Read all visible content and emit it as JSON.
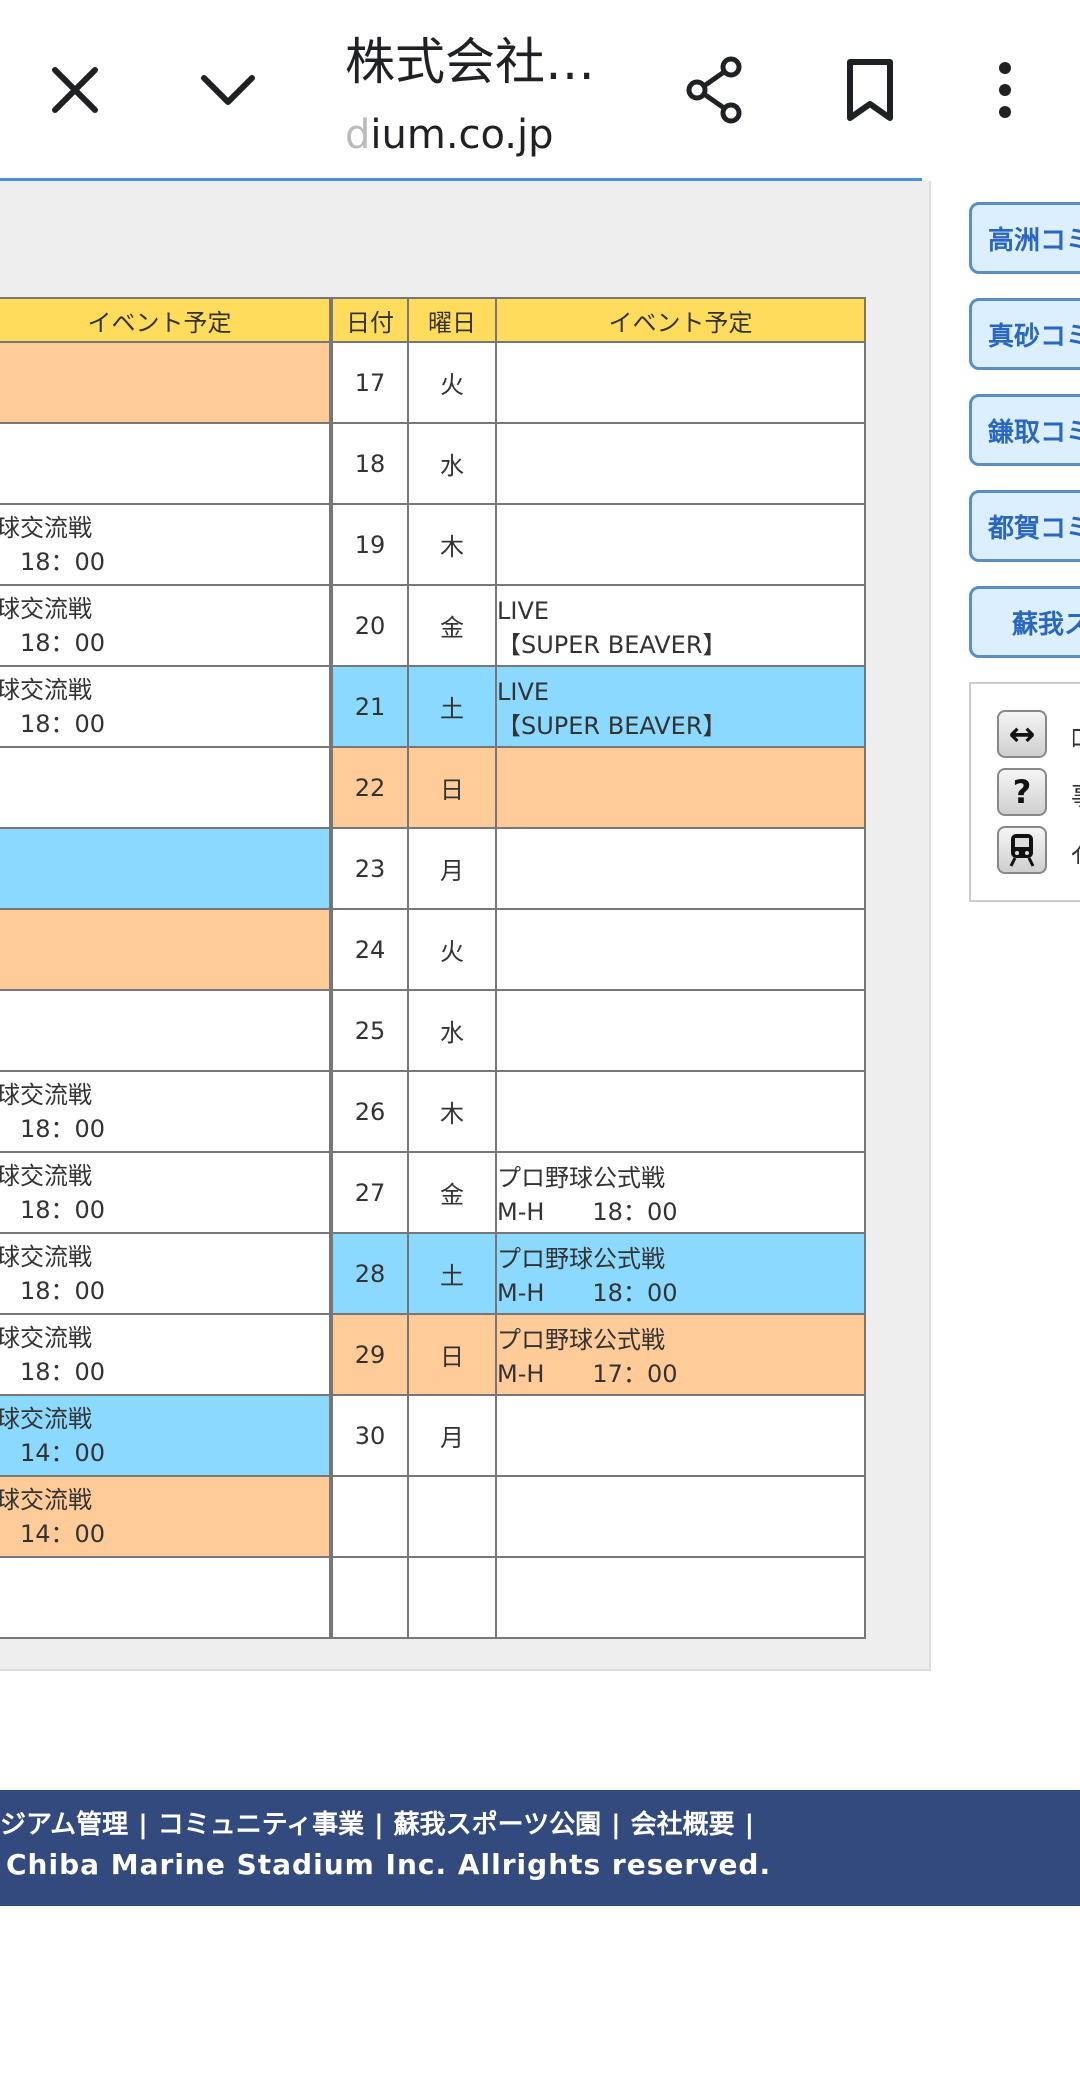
{
  "browser": {
    "title": "株式会社…",
    "url_faded": "d",
    "url": "ium.co.jp",
    "icons": [
      "close-icon",
      "chevron-down-icon",
      "share-icon",
      "bookmark-icon",
      "more-vert-icon"
    ]
  },
  "table": {
    "headers": {
      "event_left": "イベント予定",
      "date": "日付",
      "weekday": "曜日",
      "event_right": "イベント予定"
    },
    "rows": [
      {
        "left": [
          "",
          ""
        ],
        "left_color": "orange",
        "date": "17",
        "weekday": "火",
        "right": [
          "",
          ""
        ],
        "day_color": "",
        "right_color": ""
      },
      {
        "left": [
          "",
          ""
        ],
        "left_color": "",
        "date": "18",
        "weekday": "水",
        "right": [
          "",
          ""
        ],
        "day_color": "",
        "right_color": ""
      },
      {
        "left": [
          "球交流戦",
          "　18：00"
        ],
        "left_color": "",
        "date": "19",
        "weekday": "木",
        "right": [
          "",
          ""
        ],
        "day_color": "",
        "right_color": ""
      },
      {
        "left": [
          "球交流戦",
          "　18：00"
        ],
        "left_color": "",
        "date": "20",
        "weekday": "金",
        "right": [
          "LIVE",
          "【SUPER BEAVER】"
        ],
        "day_color": "",
        "right_color": ""
      },
      {
        "left": [
          "球交流戦",
          "　18：00"
        ],
        "left_color": "",
        "date": "21",
        "weekday": "土",
        "right": [
          "LIVE",
          "【SUPER BEAVER】"
        ],
        "day_color": "blue",
        "right_color": "blue"
      },
      {
        "left": [
          "",
          ""
        ],
        "left_color": "",
        "date": "22",
        "weekday": "日",
        "right": [
          "",
          ""
        ],
        "day_color": "orange",
        "right_color": "orange"
      },
      {
        "left": [
          "",
          ""
        ],
        "left_color": "blue",
        "date": "23",
        "weekday": "月",
        "right": [
          "",
          ""
        ],
        "day_color": "",
        "right_color": ""
      },
      {
        "left": [
          "",
          ""
        ],
        "left_color": "orange",
        "date": "24",
        "weekday": "火",
        "right": [
          "",
          ""
        ],
        "day_color": "",
        "right_color": ""
      },
      {
        "left": [
          "",
          ""
        ],
        "left_color": "",
        "date": "25",
        "weekday": "水",
        "right": [
          "",
          ""
        ],
        "day_color": "",
        "right_color": ""
      },
      {
        "left": [
          "球交流戦",
          "　18：00"
        ],
        "left_color": "",
        "date": "26",
        "weekday": "木",
        "right": [
          "",
          ""
        ],
        "day_color": "",
        "right_color": ""
      },
      {
        "left": [
          "球交流戦",
          "　18：00"
        ],
        "left_color": "",
        "date": "27",
        "weekday": "金",
        "right": [
          "プロ野球公式戦",
          "M-H　　18：00"
        ],
        "day_color": "",
        "right_color": ""
      },
      {
        "left": [
          "球交流戦",
          "　18：00"
        ],
        "left_color": "",
        "date": "28",
        "weekday": "土",
        "right": [
          "プロ野球公式戦",
          "M-H　　18：00"
        ],
        "day_color": "blue",
        "right_color": "blue"
      },
      {
        "left": [
          "球交流戦",
          "　18：00"
        ],
        "left_color": "",
        "date": "29",
        "weekday": "日",
        "right": [
          "プロ野球公式戦",
          "M-H　　17：00"
        ],
        "day_color": "orange",
        "right_color": "orange"
      },
      {
        "left": [
          "球交流戦",
          "　14：00"
        ],
        "left_color": "blue",
        "date": "30",
        "weekday": "月",
        "right": [
          "",
          ""
        ],
        "day_color": "",
        "right_color": ""
      },
      {
        "left": [
          "球交流戦",
          "　14：00"
        ],
        "left_color": "orange",
        "date": "",
        "weekday": "",
        "right": [
          "",
          ""
        ],
        "day_color": "",
        "right_color": ""
      },
      {
        "left": [
          "",
          ""
        ],
        "left_color": "",
        "date": "",
        "weekday": "",
        "right": [
          "",
          ""
        ],
        "day_color": "",
        "right_color": ""
      }
    ]
  },
  "sidebar": {
    "buttons": [
      "高洲コミ",
      "真砂コミ",
      "鎌取コミ",
      "都賀コミ",
      "蘇我ス"
    ],
    "legend": [
      {
        "icon": "double-arrow-icon",
        "glyph": "↔",
        "text": "ﾛ"
      },
      {
        "icon": "question-icon",
        "glyph": "?",
        "text": "事"
      },
      {
        "icon": "train-icon",
        "glyph": "🚆",
        "text": "ｲ"
      }
    ]
  },
  "footer": {
    "links": [
      "ジアム管理",
      "コミュニティ事業",
      "蘇我スポーツ公園",
      "会社概要"
    ],
    "copyright": "Chiba Marine Stadium Inc. Allrights reserved."
  }
}
